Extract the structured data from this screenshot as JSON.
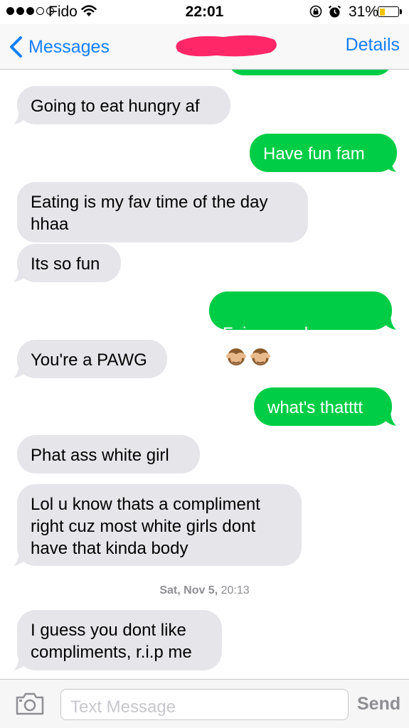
{
  "status_bar": {
    "carrier": "Fido",
    "signal_bars_filled": 3,
    "signal_bars_total": 5,
    "time": "22:01",
    "battery_percent_label": "31%",
    "battery_level": 0.31,
    "battery_color": "#f5c400",
    "icons": [
      "signal-dots-icon",
      "wifi-icon",
      "rotation-lock-icon",
      "alarm-icon",
      "battery-icon"
    ]
  },
  "nav": {
    "back_label": "Messages",
    "details_label": "Details",
    "accent_color": "#147efb",
    "redaction_color": "#ff2767"
  },
  "messages": [
    {
      "direction": "incoming",
      "text": "Going to eat hungry af"
    },
    {
      "direction": "outgoing",
      "text": "Have fun fam"
    },
    {
      "direction": "incoming",
      "text": "Eating is my fav time of the day\nhhaa"
    },
    {
      "direction": "incoming",
      "text": "Its so fun"
    },
    {
      "direction": "outgoing",
      "text": "Fair enough",
      "emoji": [
        "see-no-evil-monkey-icon",
        "see-no-evil-monkey-icon"
      ]
    },
    {
      "direction": "incoming",
      "text": "You're a PAWG"
    },
    {
      "direction": "outgoing",
      "text": "what's thatttt"
    },
    {
      "direction": "incoming",
      "text": "Phat ass white girl"
    },
    {
      "direction": "incoming",
      "text": "Lol u know thats a compliment\nright cuz most white girls dont\nhave that kinda body"
    },
    {
      "direction": "incoming",
      "text": "I guess you dont like\ncompliments, r.i.p me"
    }
  ],
  "timestamp": {
    "date": "Sat, Nov 5,",
    "time": "20:13"
  },
  "colors": {
    "incoming_bubble": "#e5e5ea",
    "outgoing_bubble": "#00cd46"
  },
  "input": {
    "placeholder": "Text Message",
    "value": "",
    "send_label": "Send",
    "camera_icon": "camera-icon"
  }
}
